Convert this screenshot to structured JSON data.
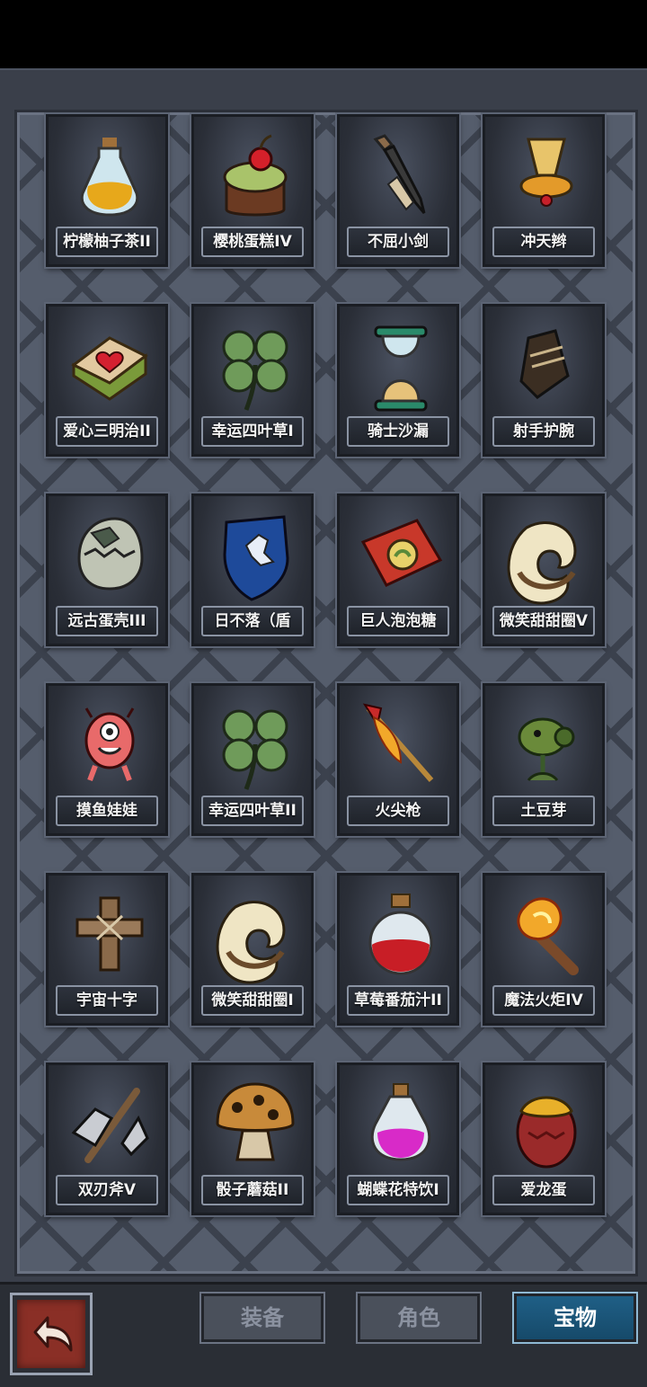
{
  "inventory": {
    "items": [
      {
        "name": "柠檬柚子茶II",
        "icon": "lemon-tea-potion-icon"
      },
      {
        "name": "樱桃蛋糕IV",
        "icon": "cherry-cake-icon"
      },
      {
        "name": "不屈小剑",
        "icon": "dagger-icon"
      },
      {
        "name": "冲天辫",
        "icon": "pigtail-icon"
      },
      {
        "name": "爱心三明治II",
        "icon": "heart-sandwich-icon"
      },
      {
        "name": "幸运四叶草I",
        "icon": "four-leaf-clover-icon"
      },
      {
        "name": "骑士沙漏",
        "icon": "hourglass-icon"
      },
      {
        "name": "射手护腕",
        "icon": "wrist-guard-icon"
      },
      {
        "name": "远古蛋壳III",
        "icon": "eggshell-icon"
      },
      {
        "name": "日不落（盾",
        "icon": "shield-icon"
      },
      {
        "name": "巨人泡泡糖",
        "icon": "bubblegum-pack-icon"
      },
      {
        "name": "微笑甜甜圈V",
        "icon": "donut-icon"
      },
      {
        "name": "摸鱼娃娃",
        "icon": "pink-doll-icon"
      },
      {
        "name": "幸运四叶草II",
        "icon": "four-leaf-clover-icon"
      },
      {
        "name": "火尖枪",
        "icon": "fire-spear-icon"
      },
      {
        "name": "土豆芽",
        "icon": "peashooter-plant-icon"
      },
      {
        "name": "宇宙十字",
        "icon": "wooden-cross-icon"
      },
      {
        "name": "微笑甜甜圈I",
        "icon": "donut-icon"
      },
      {
        "name": "草莓番茄汁II",
        "icon": "red-potion-icon"
      },
      {
        "name": "魔法火炬IV",
        "icon": "torch-icon"
      },
      {
        "name": "双刃斧V",
        "icon": "double-axe-icon"
      },
      {
        "name": "骰子蘑菇II",
        "icon": "mushroom-icon"
      },
      {
        "name": "蝴蝶花特饮I",
        "icon": "pink-potion-icon"
      },
      {
        "name": "爱龙蛋",
        "icon": "dragon-egg-icon"
      }
    ]
  },
  "navigation": {
    "back_icon": "back-arrow-icon",
    "tabs": [
      {
        "label": "装备",
        "active": false
      },
      {
        "label": "角色",
        "active": false
      },
      {
        "label": "宝物",
        "active": true
      }
    ]
  },
  "colors": {
    "active_tab": "#1f5f86",
    "back_button": "#8a2f26",
    "panel": "#555d6c"
  }
}
